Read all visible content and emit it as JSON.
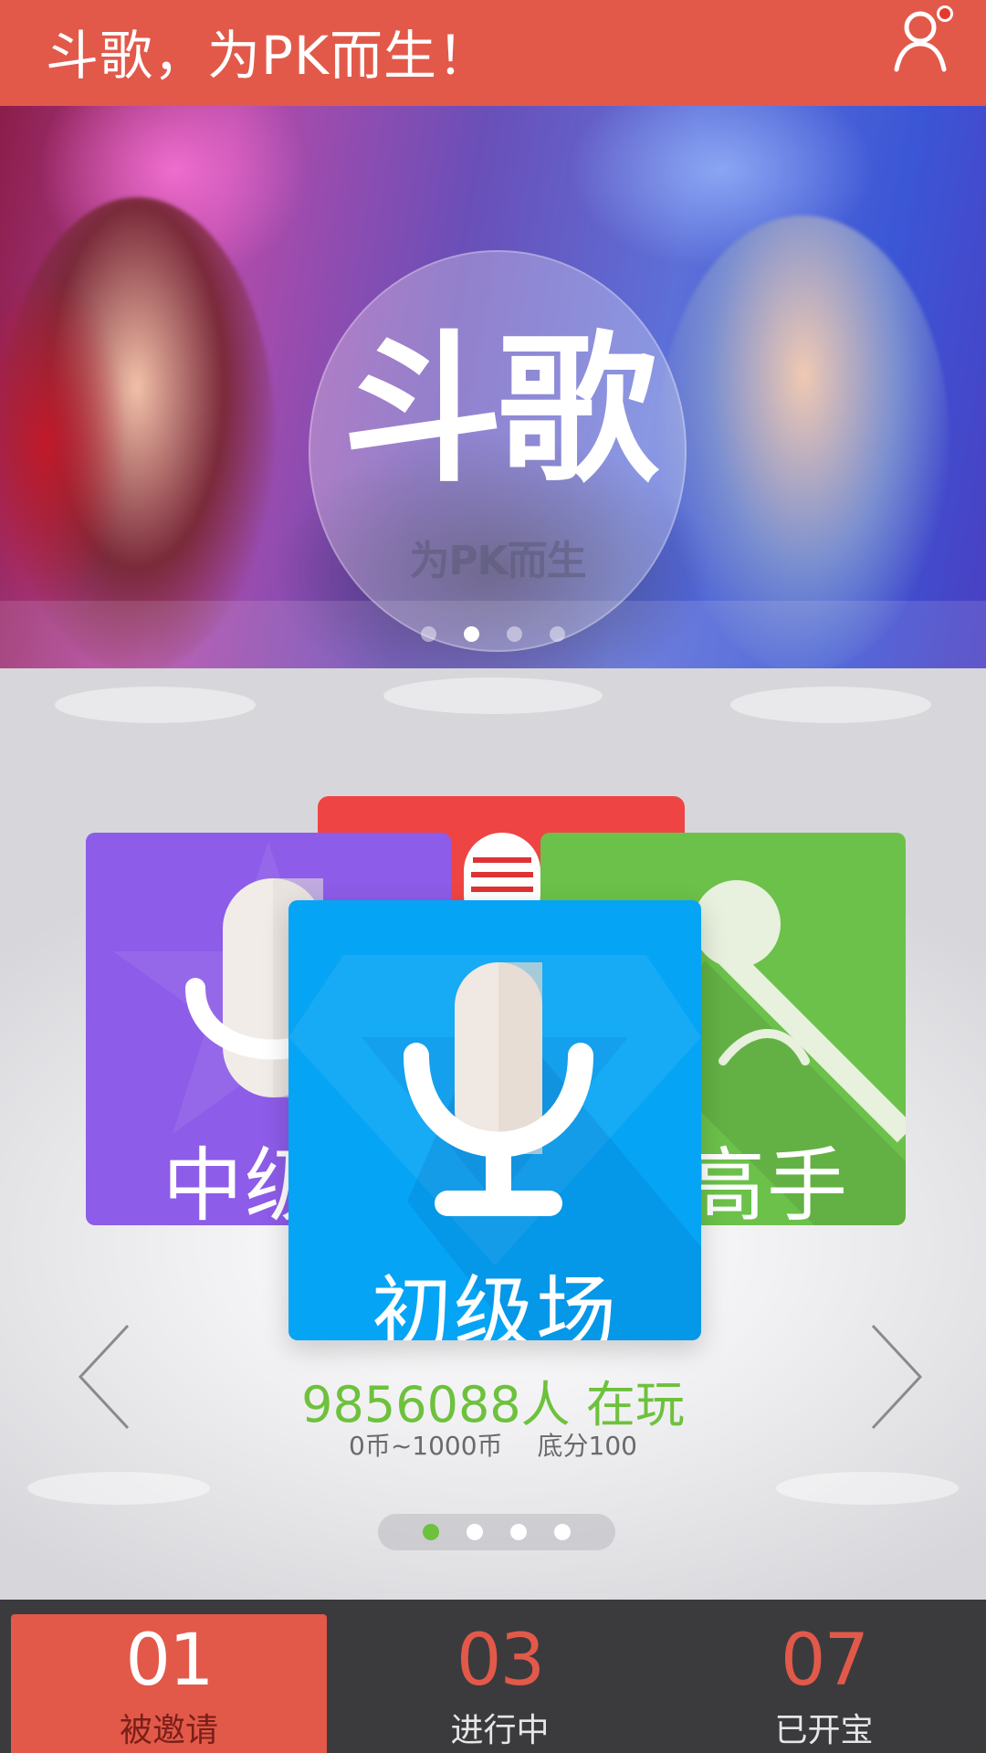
{
  "header": {
    "title": "斗歌，为PK而生！"
  },
  "banner": {
    "logo_main": "斗歌",
    "logo_sub": "为PK而生",
    "slide_count": 4,
    "active_slide": 1
  },
  "rooms": {
    "cards": [
      {
        "label": "初级场",
        "color": "#06a4f5",
        "active": true
      },
      {
        "label": "中级场",
        "color": "#8d5ce8"
      },
      {
        "label": "高手场",
        "color": "#6cc14a"
      },
      {
        "label": "",
        "color": "#ef4444"
      }
    ],
    "players_text": "9856088人 在玩",
    "coin_range": "0币~1000币",
    "base_score": "底分100",
    "page_count": 4,
    "active_page": 0
  },
  "tabs": [
    {
      "number": "01",
      "label": "被邀请",
      "active": true
    },
    {
      "number": "03",
      "label": "进行中",
      "active": false
    },
    {
      "number": "07",
      "label": "已开宝",
      "active": false
    }
  ],
  "colors": {
    "accent": "#e2594a",
    "green": "#6ec13c",
    "tab_bar": "#3b3b3d"
  }
}
